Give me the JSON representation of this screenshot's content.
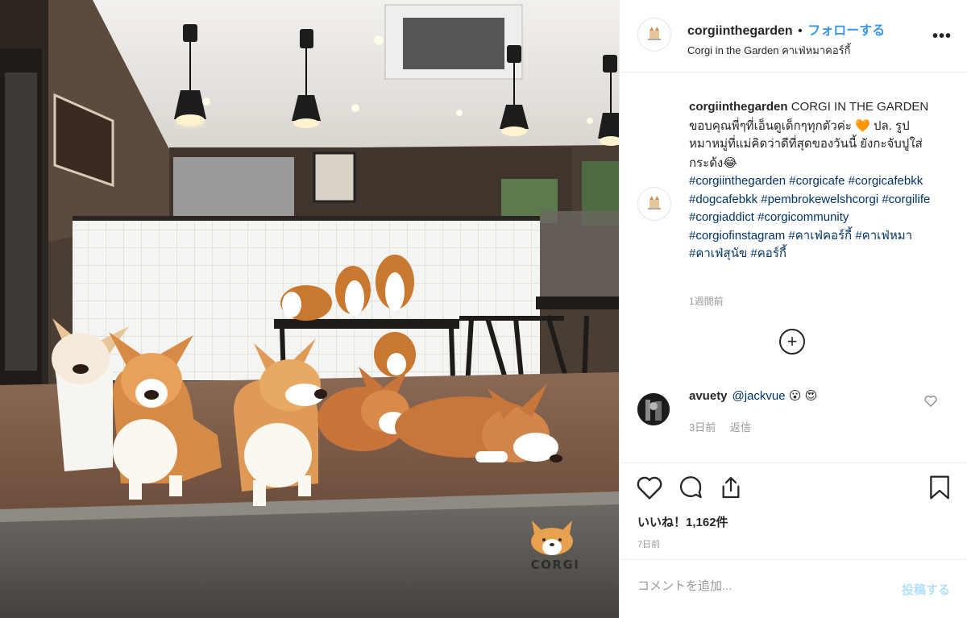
{
  "header": {
    "username": "corgiinthegarden",
    "separator": "•",
    "follow_label": "フォローする",
    "location": "Corgi in the Garden คาเฟ่หมาคอร์กี้",
    "more_icon": "more-horizontal-icon",
    "more_glyph": "•••"
  },
  "caption": {
    "username": "corgiinthegarden",
    "text1": "CORGI IN THE GARDEN ขอบคุณพี่ๆที่เอ็นดูเด็กๆทุกตัวค่ะ",
    "heart_emoji": "🧡",
    "text2": "ปล. รูปหมาหมู่ที่แม่คิดว่าดีที่สุดของวันนี้ ยังกะจับปูใส่กระด้ง",
    "emoji2": "😂",
    "hashtags": [
      "#corgiinthegarden",
      "#corgicafe",
      "#corgicafebkk",
      "#dogcafebkk",
      "#pembrokewelshcorgi",
      "#corgilife",
      "#corgiaddict",
      "#corgicommunity",
      "#corgiofinstagram",
      "#คาเฟ่คอร์กี้",
      "#คาเฟ่หมา",
      "#คาเฟ่สุนัข",
      "#คอร์กี้"
    ],
    "time": "1週間前"
  },
  "load_more": {
    "icon": "plus-circle-icon",
    "glyph": "+"
  },
  "comment": {
    "username": "avuety",
    "mention": "@jackvue",
    "emojis": "😮 😍",
    "time": "3日前",
    "reply_label": "返信"
  },
  "actions": {
    "like_icon": "heart-outline-icon",
    "comment_icon": "comment-bubble-icon",
    "share_icon": "share-upload-icon",
    "save_icon": "bookmark-icon",
    "likes_text": "いいね！1,162件",
    "date": "7日前"
  },
  "comment_box": {
    "placeholder": "コメントを追加...",
    "post_label": "投稿する"
  },
  "photo": {
    "watermark": "CORGI",
    "alt": "Corgi photo"
  },
  "colors": {
    "accent": "#3897f0",
    "hashtag": "#003569",
    "muted": "#999999",
    "post_disabled": "#b2dffc"
  }
}
